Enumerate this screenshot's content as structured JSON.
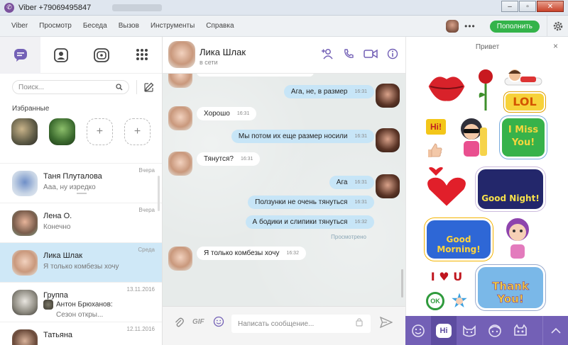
{
  "window": {
    "title": "Viber +79069495847"
  },
  "menu": {
    "items": [
      "Viber",
      "Просмотр",
      "Беседа",
      "Вызов",
      "Инструменты",
      "Справка"
    ],
    "topup": "Пополнить",
    "more": "•••"
  },
  "sidebar": {
    "search_placeholder": "Поиск...",
    "favorites_title": "Избранные",
    "add_symbol": "+",
    "chats": [
      {
        "name": "Таня Плуталова",
        "preview": "Ааа, ну изредко",
        "date": "Вчера"
      },
      {
        "name": "Лена О.",
        "preview": "Конечно",
        "date": "Вчера"
      },
      {
        "name": "Лика Шлак",
        "preview": "Я только комбезы хочу",
        "date": "Среда"
      },
      {
        "name": "Группа",
        "preview_sender": "Антон Брюханов:",
        "preview": "Сезон откры...",
        "date": "13.11.2016"
      },
      {
        "name": "Татьяна",
        "preview": "",
        "date": "12.11.2016"
      }
    ]
  },
  "conversation": {
    "name": "Лика Шлак",
    "status": "в сети",
    "messages": [
      {
        "text": "Ага, не, в размер",
        "time": "16:31",
        "dir": "out"
      },
      {
        "text": "Хорошо",
        "time": "16:31",
        "dir": "in"
      },
      {
        "text": "Мы потом их еще размер носили",
        "time": "16:31",
        "dir": "out"
      },
      {
        "text": "Тянутся?",
        "time": "16:31",
        "dir": "in"
      },
      {
        "text": "Ага",
        "time": "16:31",
        "dir": "out"
      },
      {
        "text": "Ползунки не очень тянуться",
        "time": "16:31",
        "dir": "out"
      },
      {
        "text": "А бодики и слипики тянуться",
        "time": "16:32",
        "dir": "out"
      },
      {
        "text": "Я только комбезы хочу",
        "time": "16:32",
        "dir": "in"
      }
    ],
    "seen": "Просмотрено",
    "composer_placeholder": "Написать сообщение...",
    "gif_label": "GIF"
  },
  "stickers": {
    "title": "Привет",
    "close": "×",
    "texts": {
      "lol": "LOL",
      "hi": "Hi!",
      "miss": "I Miss You!",
      "night": "Good Night!",
      "morning": "Good Morning!",
      "iou": "I ♥ U",
      "ok": "OK",
      "thank": "Thank You!"
    },
    "tab_hi": "Hi"
  },
  "colors": {
    "viber_purple": "#7360b6",
    "topup_green": "#34b34a",
    "bubble_out": "#c7e5f7",
    "active_chat": "#cfe8f7"
  }
}
